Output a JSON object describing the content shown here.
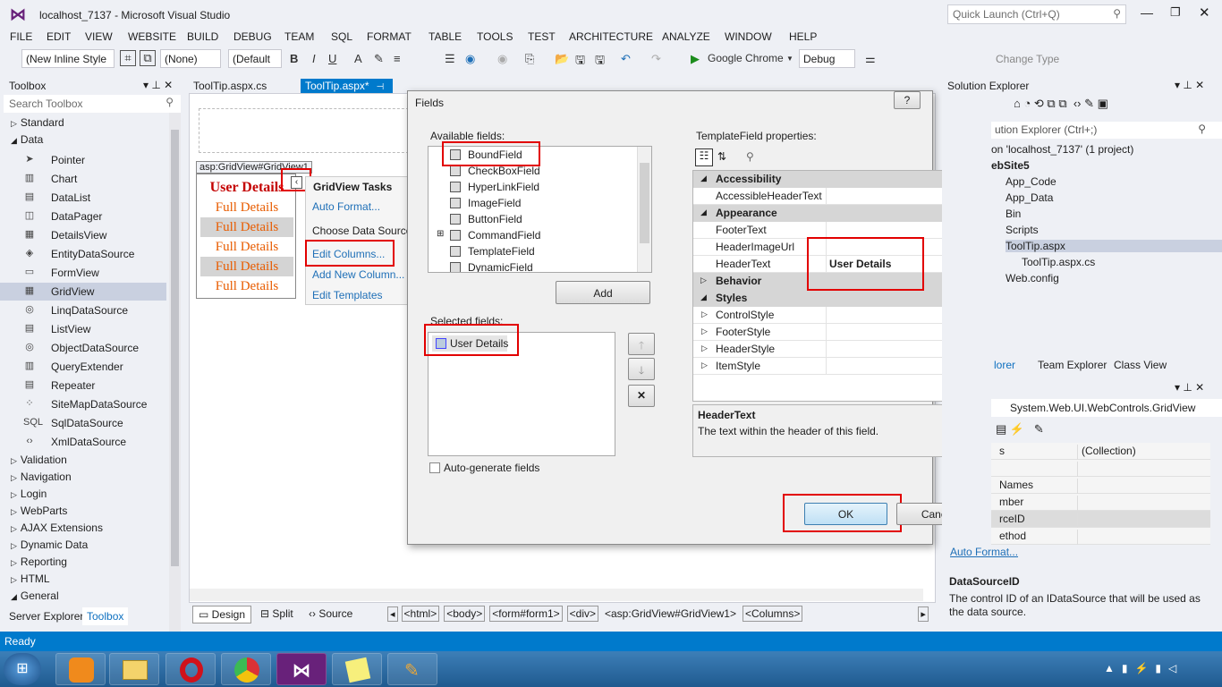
{
  "window": {
    "title": "localhost_7137 - Microsoft Visual Studio",
    "quick_launch": "Quick Launch (Ctrl+Q)"
  },
  "menu": [
    "FILE",
    "EDIT",
    "VIEW",
    "WEBSITE",
    "BUILD",
    "DEBUG",
    "TEAM",
    "SQL",
    "FORMAT",
    "TABLE",
    "TOOLS",
    "TEST",
    "ARCHITECTURE",
    "ANALYZE",
    "WINDOW",
    "HELP"
  ],
  "toolbar": {
    "style_combo": "(New Inline Style",
    "none_combo": "(None)",
    "default_combo": "(Default",
    "bold": "B",
    "italic": "I",
    "underline": "U",
    "browser": "Google Chrome",
    "config": "Debug",
    "change_type": "Change Type"
  },
  "toolbox": {
    "title": "Toolbox",
    "search_placeholder": "Search Toolbox",
    "groups_top": [
      "Standard",
      "Data"
    ],
    "data_items": [
      "Pointer",
      "Chart",
      "DataList",
      "DataPager",
      "DetailsView",
      "EntityDataSource",
      "FormView",
      "GridView",
      "LinqDataSource",
      "ListView",
      "ObjectDataSource",
      "QueryExtender",
      "Repeater",
      "SiteMapDataSource",
      "SqlDataSource",
      "XmlDataSource"
    ],
    "data_icons": [
      "➤",
      "▥",
      "▤",
      "◫",
      "▦",
      "◈",
      "▭",
      "▦",
      "◎",
      "▤",
      "◎",
      "▥",
      "▤",
      "⁘",
      "SQL",
      "‹›"
    ],
    "groups_bottom": [
      "Validation",
      "Navigation",
      "Login",
      "WebParts",
      "AJAX Extensions",
      "Dynamic Data",
      "Reporting",
      "HTML",
      "General"
    ],
    "tabs": [
      "Server Explorer",
      "Toolbox"
    ]
  },
  "editor": {
    "tabs": [
      "ToolTip.aspx.cs",
      "ToolTip.aspx*"
    ],
    "grid_tag": "asp:GridView#GridView1",
    "grid_header": "User Details",
    "grid_rows": [
      "Full Details",
      "Full Details",
      "Full Details",
      "Full Details",
      "Full Details"
    ],
    "tasks": {
      "title": "GridView Tasks",
      "items": [
        "Auto Format...",
        "Choose Data Source",
        "Edit Columns...",
        "Add New Column...",
        "Edit Templates"
      ]
    },
    "view_tabs": [
      "Design",
      "Split",
      "Source"
    ],
    "breadcrumbs": [
      "<html>",
      "<body>",
      "<form#form1>",
      "<div>",
      "<asp:GridView#GridView1>",
      "<Columns>"
    ]
  },
  "dialog": {
    "title": "Fields",
    "help": "?",
    "available_label": "Available fields:",
    "available": [
      "BoundField",
      "CheckBoxField",
      "HyperLinkField",
      "ImageField",
      "ButtonField",
      "CommandField",
      "TemplateField",
      "DynamicField"
    ],
    "add_button": "Add",
    "selected_label": "Selected fields:",
    "selected": [
      "User Details"
    ],
    "autogen_label": "Auto-generate fields",
    "props_label": "TemplateField properties:",
    "properties": [
      {
        "type": "cat",
        "name": "Accessibility"
      },
      {
        "type": "prop",
        "name": "AccessibleHeaderText",
        "value": ""
      },
      {
        "type": "cat",
        "name": "Appearance"
      },
      {
        "type": "prop",
        "name": "FooterText",
        "value": ""
      },
      {
        "type": "prop",
        "name": "HeaderImageUrl",
        "value": ""
      },
      {
        "type": "prop",
        "name": "HeaderText",
        "value": "User Details"
      },
      {
        "type": "cat",
        "name": "Behavior"
      },
      {
        "type": "cat",
        "name": "Styles"
      },
      {
        "type": "prop",
        "name": "ControlStyle",
        "value": ""
      },
      {
        "type": "prop",
        "name": "FooterStyle",
        "value": ""
      },
      {
        "type": "prop",
        "name": "HeaderStyle",
        "value": ""
      },
      {
        "type": "prop",
        "name": "ItemStyle",
        "value": ""
      }
    ],
    "desc_title": "HeaderText",
    "desc_text": "The text within the header of this field.",
    "ok": "OK",
    "cancel": "Cancel"
  },
  "solution": {
    "title": "Solution Explorer",
    "search": "ution Explorer (Ctrl+;)",
    "items": [
      "on 'localhost_7137' (1 project)",
      "ebSite5",
      "App_Code",
      "App_Data",
      "Bin",
      "Scripts",
      "ToolTip.aspx",
      "ToolTip.aspx.cs",
      "Web.config"
    ],
    "tabs": [
      "lorer",
      "Team Explorer",
      "Class View"
    ]
  },
  "properties_panel": {
    "object": "System.Web.UI.WebControls.GridView",
    "rows": [
      {
        "name": "s",
        "value": "(Collection)"
      },
      {
        "name": "",
        "value": ""
      },
      {
        "name": "Names",
        "value": ""
      },
      {
        "name": "mber",
        "value": ""
      },
      {
        "name": "rceID",
        "value": ""
      },
      {
        "name": "ethod",
        "value": ""
      }
    ],
    "link": "Auto Format...",
    "desc_title": "DataSourceID",
    "desc_text": "The control ID of an IDataSource that will be used as the data source."
  },
  "status": {
    "text": "Ready"
  }
}
